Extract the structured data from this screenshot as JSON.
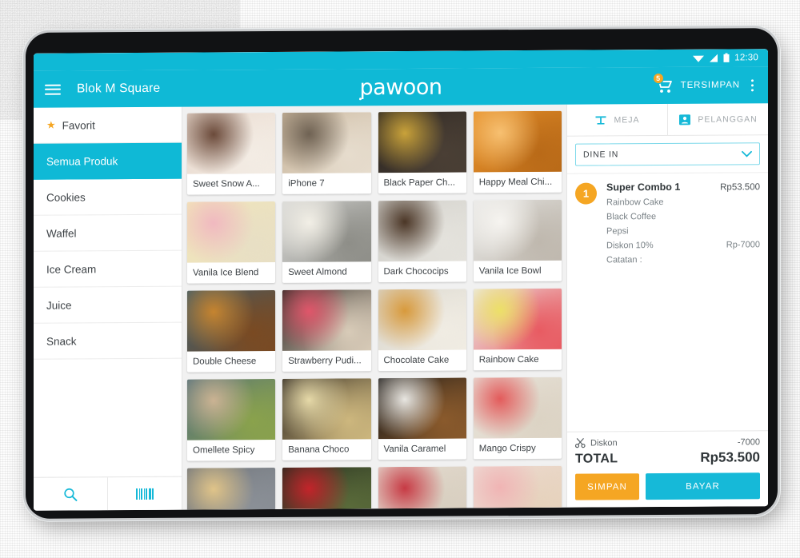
{
  "statusbar": {
    "time": "12:30",
    "wifi_icon": "wifi-icon",
    "signal_icon": "signal-icon",
    "battery_icon": "battery-icon"
  },
  "appbar": {
    "menu_icon": "hamburger-menu-icon",
    "store_name": "Blok M Square",
    "brand": "pawoon",
    "cart_icon": "shopping-cart-icon",
    "cart_badge": "5",
    "saved_label": "TERSIMPAN",
    "overflow_icon": "kebab-menu-icon"
  },
  "sidebar": {
    "items": [
      {
        "label": "Favorit",
        "icon": "star-icon",
        "active": false
      },
      {
        "label": "Semua Produk",
        "active": true
      },
      {
        "label": "Cookies",
        "active": false
      },
      {
        "label": "Waffel",
        "active": false
      },
      {
        "label": "Ice Cream",
        "active": false
      },
      {
        "label": "Juice",
        "active": false
      },
      {
        "label": "Snack",
        "active": false
      }
    ],
    "footer": {
      "search_icon": "search-icon",
      "barcode_icon": "barcode-scanner-icon"
    }
  },
  "products": [
    {
      "name": "Sweet Snow A...",
      "c1": "#e8d8cc",
      "c2": "#6b4a3a",
      "c3": "#f3ece4"
    },
    {
      "name": "iPhone 7",
      "c1": "#c8b59b",
      "c2": "#6f6253",
      "c3": "#e6dccd"
    },
    {
      "name": "Black Paper Ch...",
      "c1": "#2b2521",
      "c2": "#c9a23a",
      "c3": "#4a3f35"
    },
    {
      "name": "Happy Meal Chi...",
      "c1": "#e8922b",
      "c2": "#f7c071",
      "c3": "#b96a18"
    },
    {
      "name": "Vanila Ice Blend",
      "c1": "#f2e6b8",
      "c2": "#f0b9c0",
      "c3": "#e8dfc4"
    },
    {
      "name": "Sweet Almond",
      "c1": "#d8d8d6",
      "c2": "#f2efe6",
      "c3": "#8e8e88"
    },
    {
      "name": "Dark Chococips",
      "c1": "#cfcec9",
      "c2": "#4b3626",
      "c3": "#e4e2dc"
    },
    {
      "name": "Vanila Ice Bowl",
      "c1": "#e9e9e7",
      "c2": "#f6f4f0",
      "c3": "#bfb8ae"
    },
    {
      "name": "Double Cheese",
      "c1": "#3f5d6b",
      "c2": "#c6842f",
      "c3": "#7a4a22"
    },
    {
      "name": "Strawberry Pudi...",
      "c1": "#2e2a26",
      "c2": "#e0566a",
      "c3": "#d8cbb8"
    },
    {
      "name": "Chocolate Cake",
      "c1": "#d9d6cd",
      "c2": "#d89a3c",
      "c3": "#f0ece3"
    },
    {
      "name": "Rainbow Cake",
      "c1": "#ecebe8",
      "c2": "#ece067",
      "c3": "#e85b62"
    },
    {
      "name": "Omellete Spicy",
      "c1": "#53707a",
      "c2": "#cbb393",
      "c3": "#8aa24c"
    },
    {
      "name": "Banana Choco",
      "c1": "#2b241d",
      "c2": "#e6d9a8",
      "c3": "#cdb77e"
    },
    {
      "name": "Vanila Caramel",
      "c1": "#1c1a18",
      "c2": "#e8e6e1",
      "c3": "#8a5a2c"
    },
    {
      "name": "Mango Crispy",
      "c1": "#e9e5dc",
      "c2": "#e35b5b",
      "c3": "#dcd3c4"
    },
    {
      "name": "",
      "c1": "#6f747a",
      "c2": "#e0c489",
      "c3": "#8b9097"
    },
    {
      "name": "",
      "c1": "#222a1e",
      "c2": "#c3242a",
      "c3": "#5a6b3a"
    },
    {
      "name": "",
      "c1": "#e6ddd2",
      "c2": "#c73a44",
      "c3": "#d8cfc0"
    },
    {
      "name": "",
      "c1": "#eedcd6",
      "c2": "#f0b4b4",
      "c3": "#e6d2bc"
    }
  ],
  "order": {
    "tabs": [
      {
        "label": "MEJA",
        "icon": "table-icon"
      },
      {
        "label": "PELANGGAN",
        "icon": "customer-icon"
      }
    ],
    "order_type": "DINE IN",
    "order_type_chevron": "chevron-down-icon",
    "items": [
      {
        "qty": "1",
        "name": "Super Combo 1",
        "price": "Rp53.500",
        "components": [
          "Rainbow Cake",
          "Black Coffee",
          "Pepsi"
        ],
        "discount_label": "Diskon 10%",
        "discount_value": "Rp-7000",
        "note_label": "Catatan :"
      }
    ],
    "footer": {
      "discount_icon": "scissors-icon",
      "discount_label": "Diskon",
      "discount_value": "-7000",
      "total_label": "TOTAL",
      "total_value": "Rp53.500",
      "save_button": "SIMPAN",
      "pay_button": "BAYAR"
    }
  },
  "colors": {
    "brand_cyan": "#0fb9d6",
    "accent_orange": "#f5a623",
    "text_dark": "#2f3538",
    "text_muted": "#7a8287"
  }
}
